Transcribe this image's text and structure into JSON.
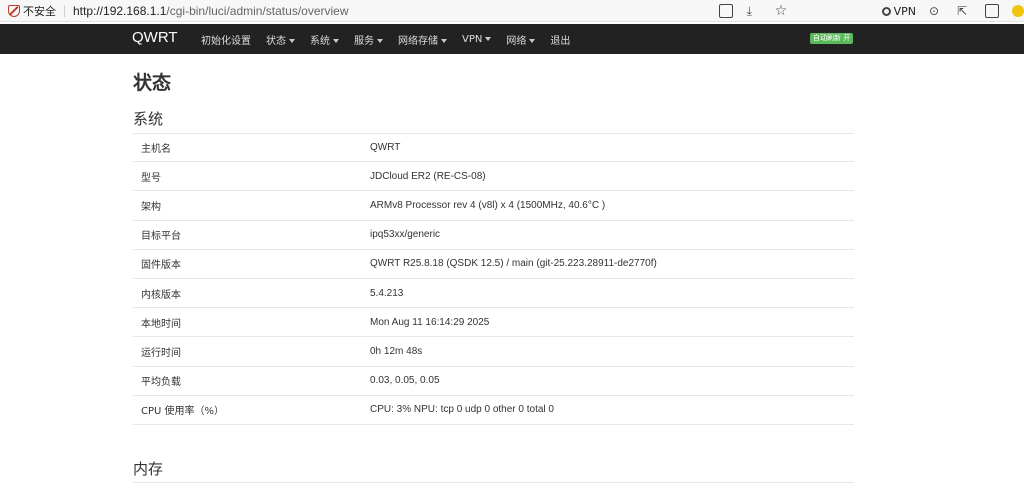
{
  "browser": {
    "security_label": "不安全",
    "url_host": "http://192.168.1.1",
    "url_path": "/cgi-bin/luci/admin/status/overview",
    "vpn_label": "VPN"
  },
  "nav": {
    "brand": "QWRT",
    "items": [
      {
        "label": "初始化设置",
        "dropdown": false
      },
      {
        "label": "状态",
        "dropdown": true
      },
      {
        "label": "系统",
        "dropdown": true
      },
      {
        "label": "服务",
        "dropdown": true
      },
      {
        "label": "网络存储",
        "dropdown": true
      },
      {
        "label": "VPN",
        "dropdown": true
      },
      {
        "label": "网络",
        "dropdown": true
      },
      {
        "label": "退出",
        "dropdown": false
      }
    ],
    "auto_refresh": "自动刷新 开",
    "accent_color": "#5cb85c"
  },
  "page": {
    "title": "状态",
    "system_section": "系统",
    "memory_section": "内存"
  },
  "system_table": [
    {
      "key": "主机名",
      "value": "QWRT"
    },
    {
      "key": "型号",
      "value": "JDCloud ER2 (RE-CS-08)"
    },
    {
      "key": "架构",
      "value": "ARMv8 Processor rev 4 (v8l) x 4 (1500MHz, 40.6°C )"
    },
    {
      "key": "目标平台",
      "value": "ipq53xx/generic"
    },
    {
      "key": "固件版本",
      "value": "QWRT R25.8.18 (QSDK 12.5) / main (git-25.223.28911-de2770f)"
    },
    {
      "key": "内核版本",
      "value": "5.4.213"
    },
    {
      "key": "本地时间",
      "value": "Mon Aug 11 16:14:29 2025"
    },
    {
      "key": "运行时间",
      "value": "0h 12m 48s"
    },
    {
      "key": "平均负载",
      "value": "0.03, 0.05, 0.05"
    },
    {
      "key": "CPU 使用率（%）",
      "value": "CPU: 3% NPU: tcp 0 udp 0 other 0 total 0"
    }
  ]
}
